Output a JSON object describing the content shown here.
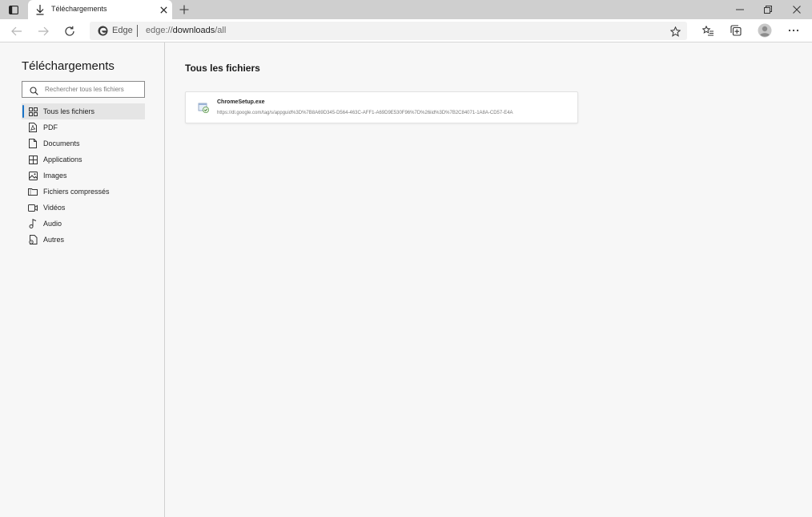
{
  "tab": {
    "title": "Téléchargements"
  },
  "omnibox": {
    "brand": "Edge",
    "url_scheme": "edge://",
    "url_host": "downloads",
    "url_path": "/all"
  },
  "sidebar": {
    "title": "Téléchargements",
    "search_placeholder": "Rechercher tous les fichiers",
    "categories": [
      {
        "label": "Tous les fichiers",
        "icon": "grid-icon",
        "selected": true
      },
      {
        "label": "PDF",
        "icon": "pdf-icon"
      },
      {
        "label": "Documents",
        "icon": "document-icon"
      },
      {
        "label": "Applications",
        "icon": "applications-icon"
      },
      {
        "label": "Images",
        "icon": "image-icon"
      },
      {
        "label": "Fichiers compressés",
        "icon": "archive-icon"
      },
      {
        "label": "Vidéos",
        "icon": "video-icon"
      },
      {
        "label": "Audio",
        "icon": "music-note-icon"
      },
      {
        "label": "Autres",
        "icon": "other-file-icon"
      }
    ]
  },
  "main": {
    "title": "Tous les fichiers",
    "downloads": [
      {
        "file_name": "ChromeSetup.exe",
        "url": "https://dl.google.com/tag/s/appguid%3D%7B8A69D345-D564-463C-AFF1-A69D9E530F96%7D%26iid%3D%7B2C84071-1A8A-CD57-E4A"
      }
    ]
  },
  "colors": {
    "accent": "#1a73c7",
    "tabstrip": "#cfcfcf",
    "sidebar_bg": "#f7f7f7"
  }
}
